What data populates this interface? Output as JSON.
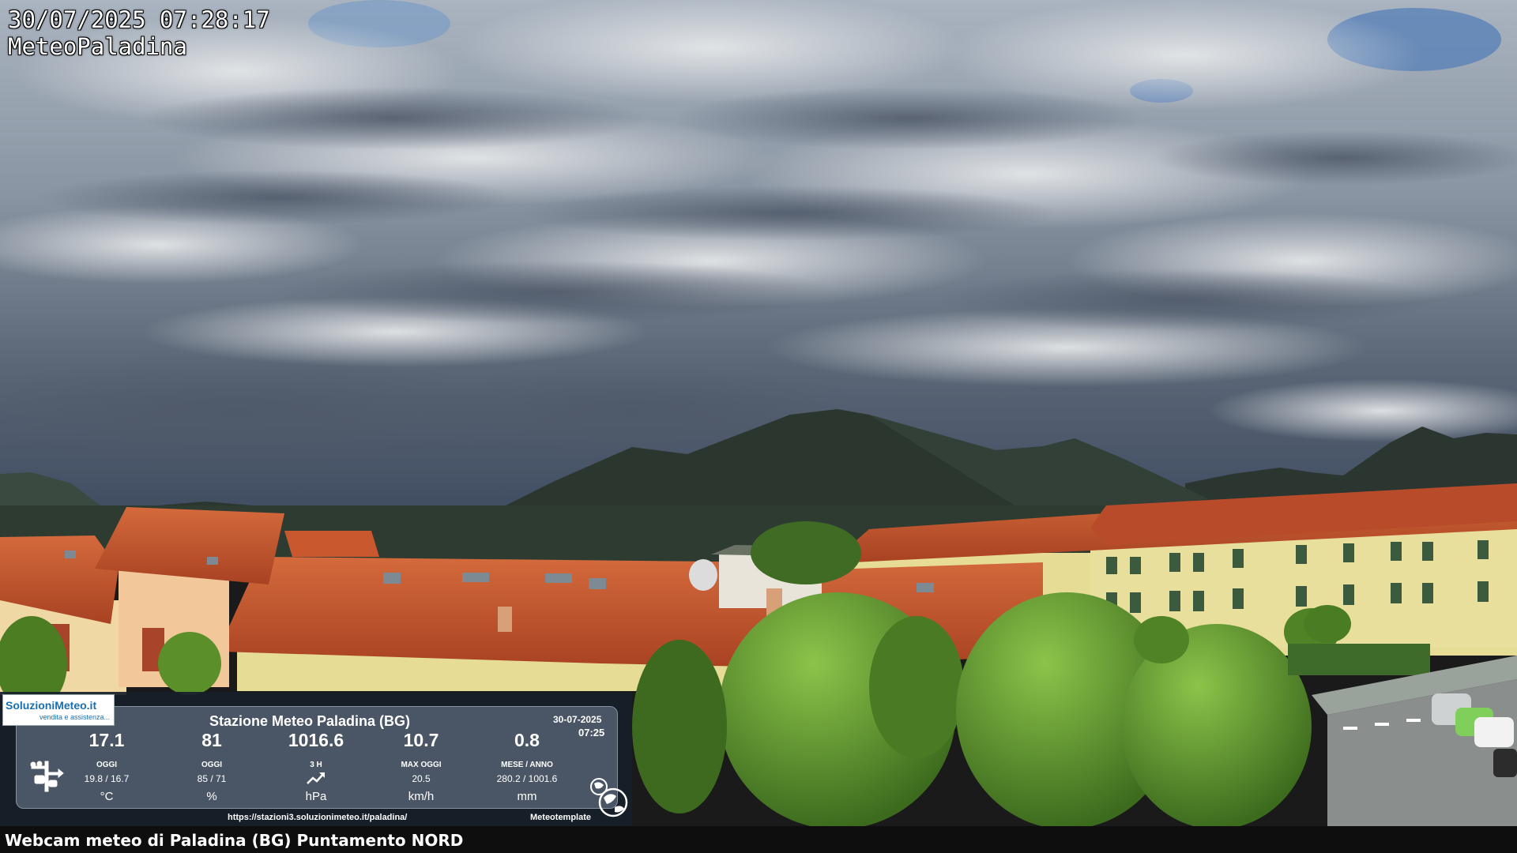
{
  "overlay": {
    "datetime": "30/07/2025 07:28:17",
    "station_name": "MeteoPaladina"
  },
  "caption": "Webcam meteo di Paladina (BG) Puntamento NORD",
  "weather_panel": {
    "logo_main": "SoluzioniMeteo.it",
    "logo_sub": "vendita e assistenza...",
    "title": "Stazione Meteo Paladina (BG)",
    "date": "30-07-2025",
    "time": "07:25",
    "metrics": [
      {
        "value": "17.1",
        "label": "OGGI",
        "sub": "19.8 / 16.7",
        "unit": "°C"
      },
      {
        "value": "81",
        "label": "OGGI",
        "sub": "85 / 71",
        "unit": "%"
      },
      {
        "value": "1016.6",
        "label": "3 H",
        "sub": "",
        "unit": "hPa",
        "trend_icon": "trend-up-icon"
      },
      {
        "value": "10.7",
        "label": "MAX OGGI",
        "sub": "20.5",
        "unit": "km/h"
      },
      {
        "value": "0.8",
        "label": "MESE / ANNO",
        "sub": "280.2 / 1001.6",
        "unit": "mm"
      }
    ],
    "url": "https://stazioni3.soluzionimeteo.it/paladina/",
    "credit": "Meteotemplate",
    "icons": [
      "weather-station-icon",
      "globe-icon"
    ]
  },
  "colors": {
    "sky_light": "#c9ced4",
    "sky_dark": "#3e4a5c",
    "mountain": "#2f3a33",
    "roof_tile": "#c4552e",
    "wall_yellow": "#e6dc96",
    "tree_green": "#5f9a2e",
    "panel_bg": "#4a5666"
  }
}
